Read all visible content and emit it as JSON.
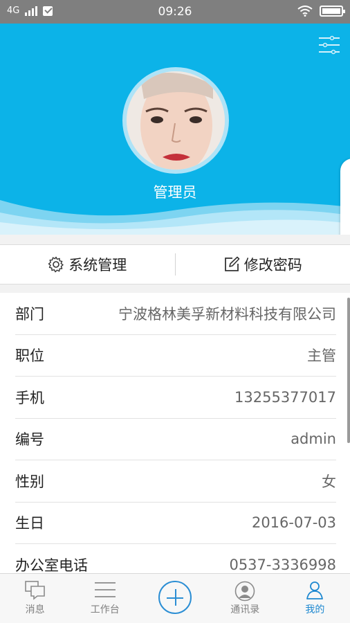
{
  "statusbar": {
    "network": "4G",
    "time": "09:26"
  },
  "header": {
    "username": "管理员",
    "bg_color": "#0cb3e8"
  },
  "actions": [
    {
      "label": "系统管理",
      "icon": "gear-icon"
    },
    {
      "label": "修改密码",
      "icon": "edit-icon"
    }
  ],
  "info": [
    {
      "label": "部门",
      "value": "宁波格林美孚新材料科技有限公司"
    },
    {
      "label": "职位",
      "value": "主管"
    },
    {
      "label": "手机",
      "value": "13255377017"
    },
    {
      "label": "编号",
      "value": "admin"
    },
    {
      "label": "性别",
      "value": "女"
    },
    {
      "label": "生日",
      "value": "2016-07-03"
    },
    {
      "label": "办公室电话",
      "value": "0537-3336998"
    }
  ],
  "nav": [
    {
      "label": "消息",
      "icon": "message-icon"
    },
    {
      "label": "工作台",
      "icon": "menu-icon"
    },
    {
      "label": "",
      "icon": "plus-icon"
    },
    {
      "label": "通讯录",
      "icon": "contacts-icon"
    },
    {
      "label": "我的",
      "icon": "user-icon",
      "active": true
    }
  ],
  "colors": {
    "accent": "#1e88d0",
    "header": "#0cb3e8"
  }
}
